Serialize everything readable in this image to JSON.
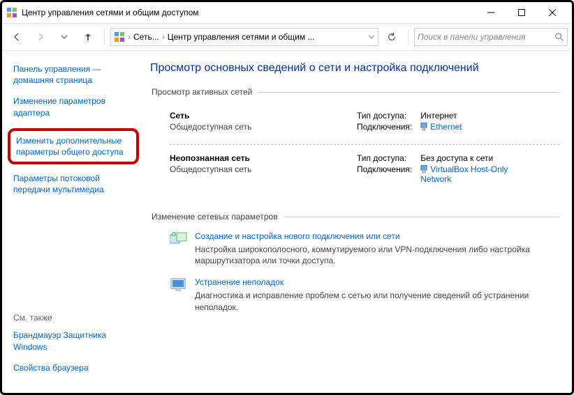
{
  "window": {
    "title": "Центр управления сетями и общим доступом"
  },
  "breadcrumb": {
    "item1": "Сеть...",
    "item2": "Центр управления сетями и общим ..."
  },
  "search": {
    "placeholder": "Поиск в панели управления"
  },
  "sidebar": {
    "home_l1": "Панель управления —",
    "home_l2": "домашняя страница",
    "adapter_l1": "Изменение параметров",
    "adapter_l2": "адаптера",
    "advanced_l1": "Изменить дополнительные",
    "advanced_l2": "параметры общего доступа",
    "streaming_l1": "Параметры потоковой",
    "streaming_l2": "передачи мультимедиа"
  },
  "seealso": {
    "header": "См. также",
    "firewall_l1": "Брандмауэр Защитника",
    "firewall_l2": "Windows",
    "browser": "Свойства браузера"
  },
  "main": {
    "heading": "Просмотр основных сведений о сети и настройка подключений",
    "active_legend": "Просмотр активных сетей",
    "change_legend": "Изменение сетевых параметров",
    "lbl_access": "Тип доступа:",
    "lbl_conn": "Подключения:",
    "net1": {
      "name": "Сеть",
      "type": "Общедоступная сеть",
      "access": "Интернет",
      "connection": "Ethernet"
    },
    "net2": {
      "name": "Неопознанная сеть",
      "type": "Общедоступная сеть",
      "access": "Без доступа к сети",
      "connection_l1": "VirtualBox Host-Only",
      "connection_l2": "Network"
    },
    "task1": {
      "title": "Создание и настройка нового подключения или сети",
      "desc": "Настройка широкополосного, коммутируемого или VPN-подключения либо настройка маршрутизатора или точки доступа."
    },
    "task2": {
      "title": "Устранение неполадок",
      "desc": "Диагностика и исправление проблем с сетью или получение сведений об устранении неполадок."
    }
  }
}
